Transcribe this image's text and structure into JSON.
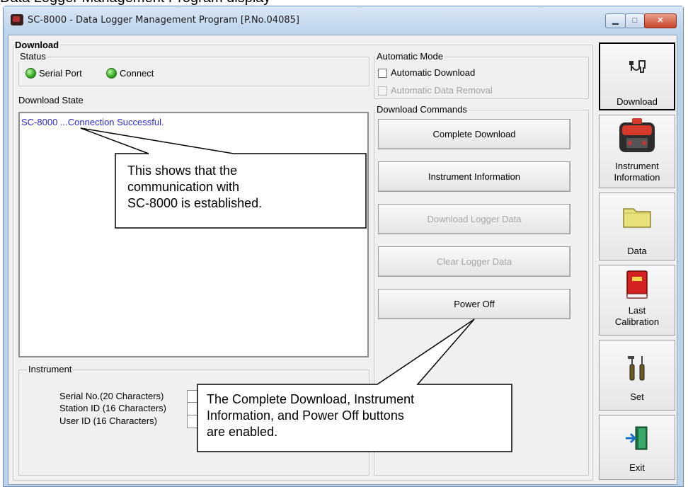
{
  "overlay": {
    "cropped_heading": "Data Logger Management Program display",
    "callout_top": "This shows that the\ncommunication with\nSC-8000 is established.",
    "callout_bottom": "The Complete Download, Instrument\nInformation, and Power Off buttons\nare enabled."
  },
  "window": {
    "title": "SC-8000 - Data Logger Management Program [P.No.04085]",
    "controls": {
      "minimize": "▁",
      "maximize": "□",
      "close": "✕"
    }
  },
  "download": {
    "group_title": "Download",
    "status": {
      "title": "Status",
      "serial_port": "Serial Port",
      "connect": "Connect",
      "led_color": "#2fa81d"
    },
    "state_label": "Download State",
    "state_text": "SC-8000 ...Connection Successful."
  },
  "automatic_mode": {
    "title": "Automatic Mode",
    "automatic_download": "Automatic Download",
    "automatic_data_removal": "Automatic Data Removal"
  },
  "commands": {
    "title": "Download Commands",
    "complete_download": "Complete Download",
    "instrument_information": "Instrument Information",
    "download_logger_data": "Download Logger Data",
    "clear_logger_data": "Clear Logger Data",
    "power_off": "Power Off"
  },
  "instrument": {
    "title": "Instrument",
    "serial_no": "Serial No.(20 Characters)",
    "station_id": "Station ID (16 Characters)",
    "user_id": "User ID (16 Characters)"
  },
  "sidebar": {
    "download": "Download",
    "instrument_info_line1": "Instrument",
    "instrument_info_line2": "Information",
    "data": "Data",
    "last_calibration_line1": "Last",
    "last_calibration_line2": "Calibration",
    "set": "Set",
    "exit": "Exit"
  }
}
